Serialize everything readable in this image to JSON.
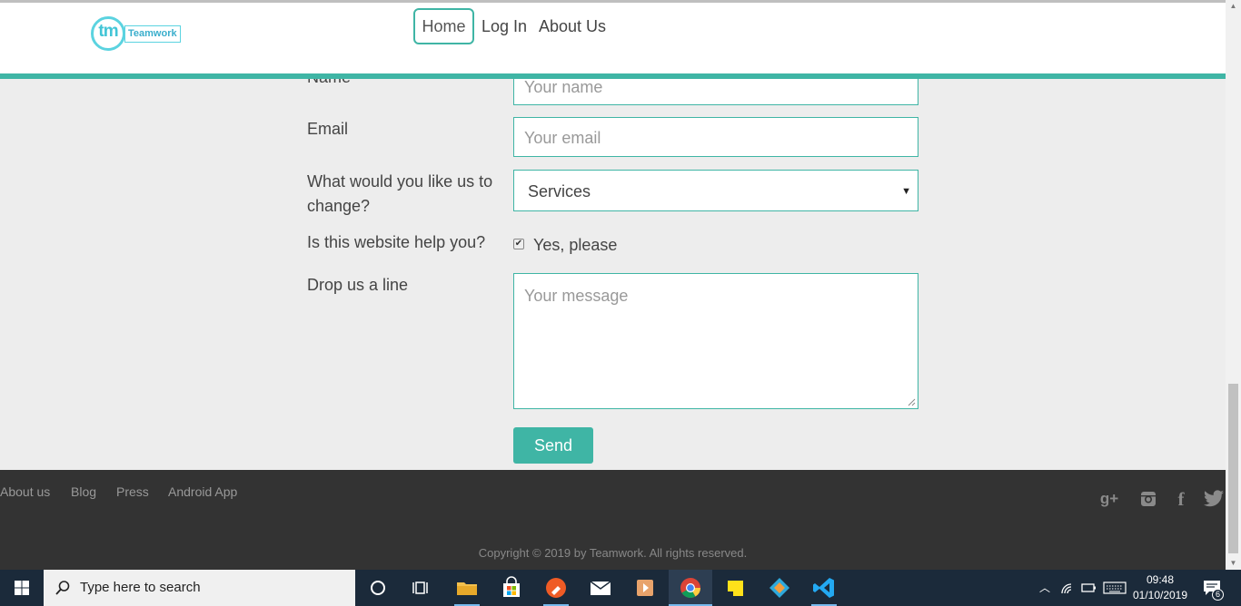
{
  "header": {
    "logo_mark": "tm",
    "logo_word": "Teamwork",
    "nav": [
      "Home",
      "Log In",
      "About Us"
    ]
  },
  "form": {
    "name_label": "Name",
    "name_placeholder": "Your name",
    "email_label": "Email",
    "email_placeholder": "Your email",
    "change_label_1": "What would you like us to",
    "change_label_2": "change?",
    "change_value": "Services",
    "help_label": "Is this website help you?",
    "help_option": "Yes, please",
    "help_checked": true,
    "message_label": "Drop us a line",
    "message_placeholder": "Your message",
    "send_label": "Send"
  },
  "footer": {
    "links": [
      "About us",
      "Blog",
      "Press",
      "Android App"
    ],
    "copyright": "Copyright © 2019 by Teamwork. All rights reserved.",
    "social_icons": [
      "google-plus-icon",
      "instagram-icon",
      "facebook-icon",
      "twitter-icon"
    ]
  },
  "taskbar": {
    "search_placeholder": "Type here to search",
    "time": "09:48",
    "date": "01/10/2019",
    "notification_count": "6"
  },
  "colors": {
    "accent": "#3fb5a5",
    "footer_bg": "#333333",
    "page_bg": "#ededed",
    "taskbar_bg": "#1b2a3a"
  }
}
